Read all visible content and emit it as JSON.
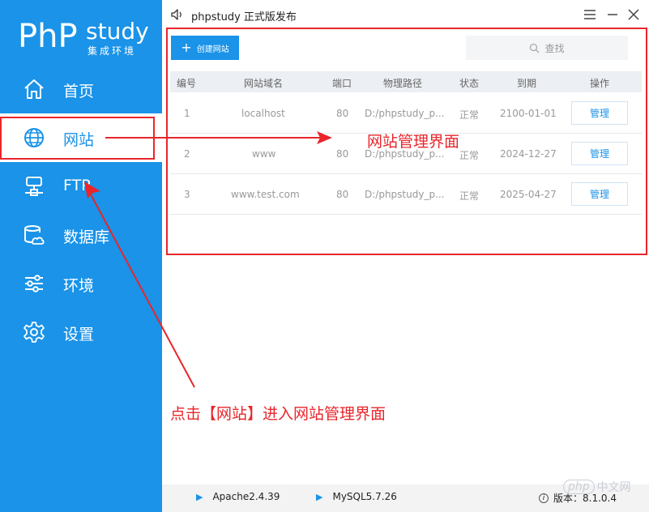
{
  "logo": {
    "php": "PhP",
    "study": "study",
    "sub": "集成环境"
  },
  "nav": [
    {
      "label": "首页",
      "icon": "home-icon"
    },
    {
      "label": "网站",
      "icon": "globe-icon"
    },
    {
      "label": "FTP",
      "icon": "ftp-icon"
    },
    {
      "label": "数据库",
      "icon": "database-icon"
    },
    {
      "label": "环境",
      "icon": "sliders-icon"
    },
    {
      "label": "设置",
      "icon": "gear-icon"
    }
  ],
  "window": {
    "title": "phpstudy 正式版发布"
  },
  "toolbar": {
    "create_label": "创建网站",
    "search_placeholder": "查找"
  },
  "table": {
    "headers": [
      "编号",
      "网站域名",
      "端口",
      "物理路径",
      "状态",
      "到期",
      "操作"
    ],
    "rows": [
      {
        "id": "1",
        "domain": "localhost",
        "port": "80",
        "path": "D:/phpstudy_p...",
        "status": "正常",
        "expiry": "2100-01-01",
        "action": "管理"
      },
      {
        "id": "2",
        "domain": "www",
        "port": "80",
        "path": "D:/phpstudy_p...",
        "status": "正常",
        "expiry": "2024-12-27",
        "action": "管理"
      },
      {
        "id": "3",
        "domain": "www.test.com",
        "port": "80",
        "path": "D:/phpstudy_p...",
        "status": "正常",
        "expiry": "2025-04-27",
        "action": "管理"
      }
    ]
  },
  "annotations": {
    "top": "网站管理界面",
    "bottom": "点击【网站】进入网站管理界面"
  },
  "statusbar": {
    "apache": "Apache2.4.39",
    "mysql": "MySQL5.7.26",
    "version": "版本：8.1.0.4"
  },
  "watermark": {
    "logo": "php",
    "text": "中文网"
  },
  "colors": {
    "accent": "#1a93e8",
    "annotation": "#e8262b"
  }
}
